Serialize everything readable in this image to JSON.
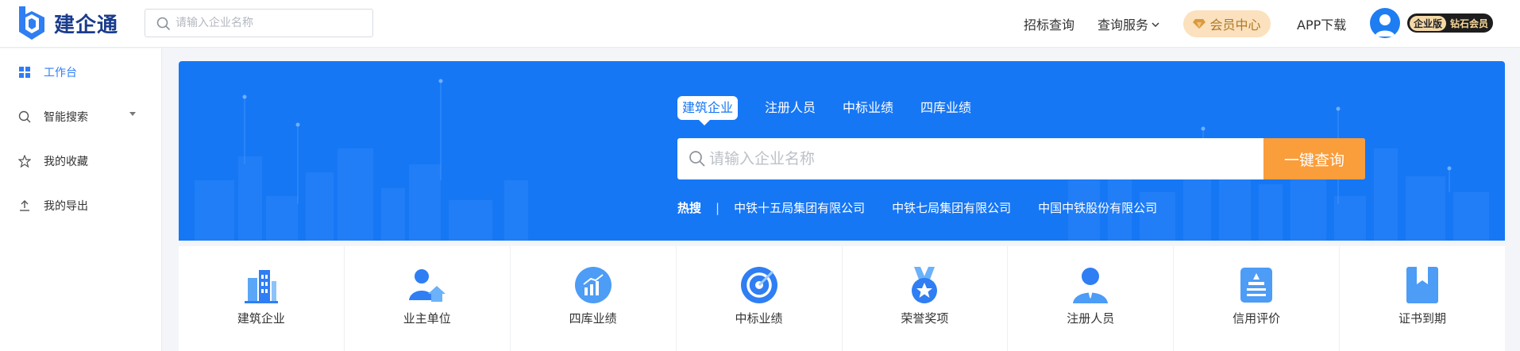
{
  "header": {
    "logo_text": "建企通",
    "search_placeholder": "请输入企业名称",
    "nav": {
      "bid_query": "招标查询",
      "query_service": "查询服务",
      "member_center": "会员中心",
      "app_download": "APP下载"
    },
    "badge": {
      "edition": "企业版",
      "level": "钻石会员"
    }
  },
  "sidebar": {
    "items": [
      {
        "label": "工作台",
        "icon": "grid-icon",
        "active": true
      },
      {
        "label": "智能搜索",
        "icon": "search-icon",
        "active": false
      },
      {
        "label": "我的收藏",
        "icon": "star-icon",
        "active": false
      },
      {
        "label": "我的导出",
        "icon": "export-icon",
        "active": false
      }
    ]
  },
  "banner": {
    "tabs": [
      "建筑企业",
      "注册人员",
      "中标业绩",
      "四库业绩"
    ],
    "active_tab": 0,
    "search_placeholder": "请输入企业名称",
    "search_button": "一键查询",
    "hot_label": "热搜",
    "hot_items": [
      "中铁十五局集团有限公司",
      "中铁七局集团有限公司",
      "中国中铁股份有限公司"
    ]
  },
  "categories": [
    {
      "label": "建筑企业",
      "icon": "building-icon"
    },
    {
      "label": "业主单位",
      "icon": "owner-icon"
    },
    {
      "label": "四库业绩",
      "icon": "chart-icon"
    },
    {
      "label": "中标业绩",
      "icon": "target-icon"
    },
    {
      "label": "荣誉奖项",
      "icon": "medal-icon"
    },
    {
      "label": "注册人员",
      "icon": "person-icon"
    },
    {
      "label": "信用评价",
      "icon": "credit-icon"
    },
    {
      "label": "证书到期",
      "icon": "certificate-icon"
    }
  ],
  "colors": {
    "brand_blue": "#1677f5",
    "accent_orange": "#fa9d3b",
    "active_link": "#2e7cf6",
    "member_bg": "#fbe1bd"
  }
}
